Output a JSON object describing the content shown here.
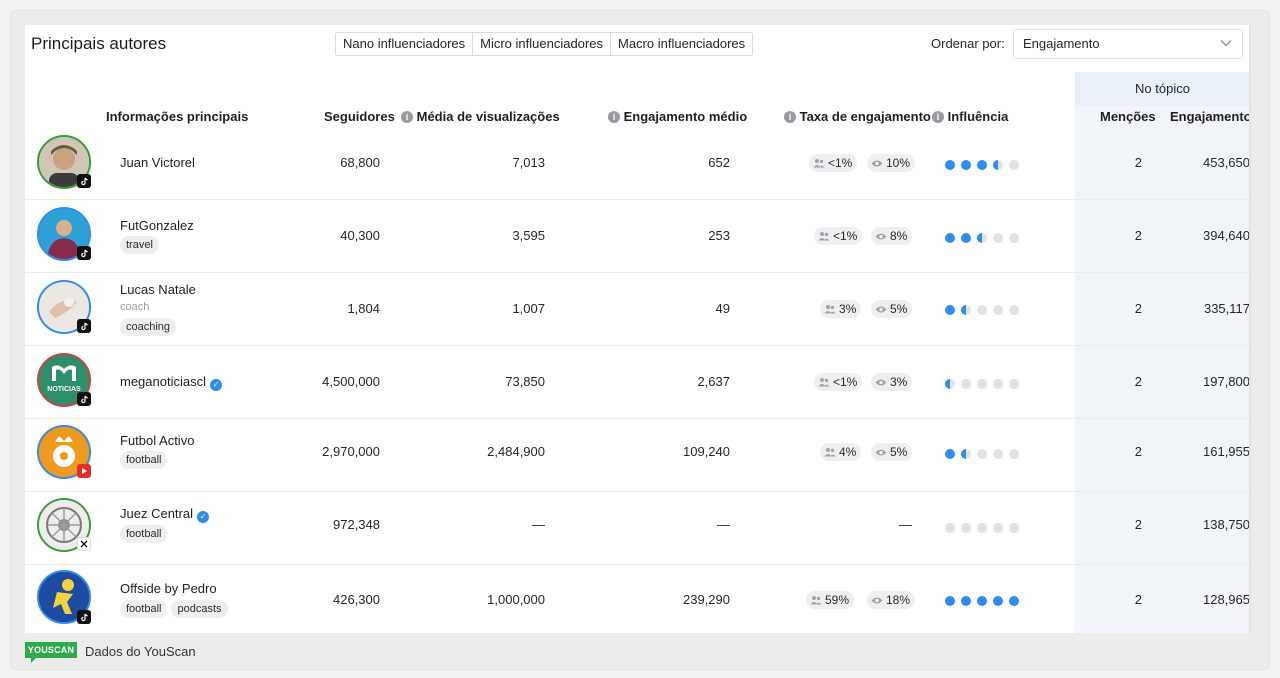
{
  "panel": {
    "title": "Principais autores",
    "segments": [
      "Nano influenciadores",
      "Micro influenciadores",
      "Macro influenciadores"
    ],
    "sort_label": "Ordenar por:",
    "sort_value": "Engajamento"
  },
  "table": {
    "topic_group": "No tópico",
    "headers": {
      "info": "Informações principais",
      "followers": "Seguidores",
      "views": "Média de visualizações",
      "engagement": "Engajamento médio",
      "rate": "Taxa de engajamento",
      "influence": "Influência",
      "mentions": "Menções",
      "topic_engagement": "Engajamento"
    },
    "rows": [
      {
        "name": "Juan Victorel",
        "subtitle": "",
        "tags": [],
        "verified": false,
        "platform": "tiktok",
        "followers": "68,800",
        "views": "7,013",
        "engagement": "652",
        "rate_followers": "<1%",
        "rate_views": "10%",
        "rate_empty": "",
        "influence": 3.5,
        "mentions": "2",
        "topic_engagement": "453,650"
      },
      {
        "name": "FutGonzalez",
        "subtitle": "",
        "tags": [
          "travel"
        ],
        "verified": false,
        "platform": "tiktok",
        "followers": "40,300",
        "views": "3,595",
        "engagement": "253",
        "rate_followers": "<1%",
        "rate_views": "8%",
        "rate_empty": "",
        "influence": 2.5,
        "mentions": "2",
        "topic_engagement": "394,640"
      },
      {
        "name": "Lucas Natale",
        "subtitle": "coach",
        "tags": [
          "coaching"
        ],
        "verified": false,
        "platform": "tiktok",
        "followers": "1,804",
        "views": "1,007",
        "engagement": "49",
        "rate_followers": "3%",
        "rate_views": "5%",
        "rate_empty": "",
        "influence": 1.5,
        "mentions": "2",
        "topic_engagement": "335,117"
      },
      {
        "name": "meganoticiascl",
        "subtitle": "",
        "tags": [],
        "verified": true,
        "platform": "tiktok",
        "followers": "4,500,000",
        "views": "73,850",
        "engagement": "2,637",
        "rate_followers": "<1%",
        "rate_views": "3%",
        "rate_empty": "",
        "influence": 0.5,
        "mentions": "2",
        "topic_engagement": "197,800"
      },
      {
        "name": "Futbol Activo",
        "subtitle": "",
        "tags": [
          "football"
        ],
        "verified": false,
        "platform": "youtube",
        "followers": "2,970,000",
        "views": "2,484,900",
        "engagement": "109,240",
        "rate_followers": "4%",
        "rate_views": "5%",
        "rate_empty": "",
        "influence": 1.5,
        "mentions": "2",
        "topic_engagement": "161,955"
      },
      {
        "name": "Juez Central",
        "subtitle": "",
        "tags": [
          "football"
        ],
        "verified": true,
        "platform": "x",
        "followers": "972,348",
        "views": "—",
        "engagement": "—",
        "rate_followers": "",
        "rate_views": "",
        "rate_empty": "—",
        "influence": 0,
        "mentions": "2",
        "topic_engagement": "138,750"
      },
      {
        "name": "Offside by Pedro",
        "subtitle": "",
        "tags": [
          "football",
          "podcasts"
        ],
        "verified": false,
        "platform": "tiktok",
        "followers": "426,300",
        "views": "1,000,000",
        "engagement": "239,290",
        "rate_followers": "59%",
        "rate_views": "18%",
        "rate_empty": "",
        "influence": 5,
        "mentions": "2",
        "topic_engagement": "128,965"
      }
    ]
  },
  "footer": {
    "logo": "YOUSCAN",
    "text": "Dados do YouScan"
  },
  "colors": {
    "accent": "#2f8cf0",
    "dot_empty": "#e2e2e5",
    "topic_band": "#f1f5fa",
    "logo_green": "#2faa4b"
  },
  "icons": {
    "rate_followers": "people-icon",
    "rate_views": "eye-icon",
    "info": "info-icon",
    "dropdown": "chevron-down-icon"
  }
}
